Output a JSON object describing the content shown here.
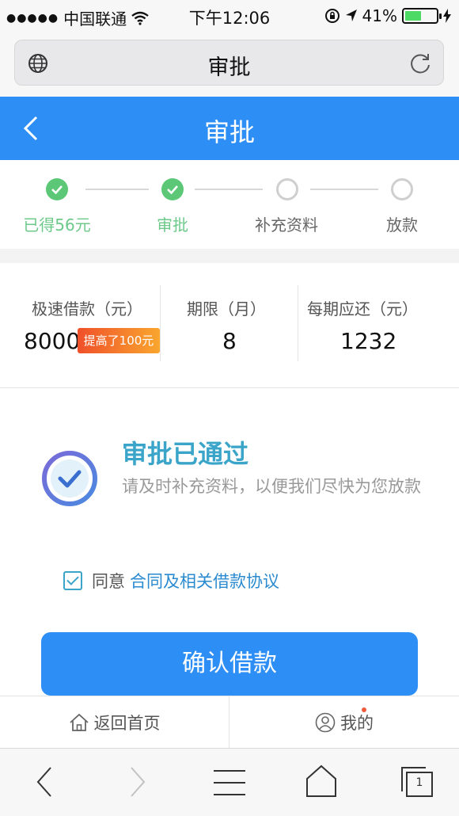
{
  "status_bar": {
    "carrier": "中国联通",
    "time": "下午12:06",
    "battery": "41%",
    "battery_level": 0.41
  },
  "browser": {
    "page_title": "审批",
    "tab_count": "1"
  },
  "header": {
    "title": "审批"
  },
  "steps": [
    {
      "label": "已得56元",
      "done": true
    },
    {
      "label": "审批",
      "done": true
    },
    {
      "label": "补充资料",
      "done": false
    },
    {
      "label": "放款",
      "done": false
    }
  ],
  "loan": {
    "amount_label": "极速借款（元）",
    "amount_value": "8000",
    "amount_badge": "提高了100元",
    "term_label": "期限（月）",
    "term_value": "8",
    "installment_label": "每期应还（元）",
    "installment_value": "1232"
  },
  "approval": {
    "title": "审批已通过",
    "description": "请及时补充资料，以便我们尽快为您放款"
  },
  "agreement": {
    "prefix": "同意",
    "link": "合同及相关借款协议",
    "checked": true
  },
  "confirm_button": "确认借款",
  "tabbar": {
    "home": "返回首页",
    "mine": "我的"
  },
  "colors": {
    "primary": "#2d8ff5",
    "success": "#5cc877",
    "accent_text": "#3aa5c9"
  }
}
